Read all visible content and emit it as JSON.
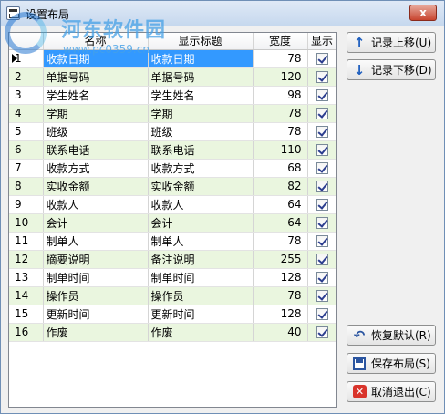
{
  "window": {
    "title": "设置布局",
    "close_label": "x"
  },
  "watermark": {
    "site": "河东软件园",
    "url": "www.pc0359.cn"
  },
  "grid": {
    "columns": [
      "",
      "名称",
      "显示标题",
      "宽度",
      "显示"
    ],
    "rows": [
      {
        "num": "1",
        "name": "收款日期",
        "display": "收款日期",
        "width": "78",
        "shown": true
      },
      {
        "num": "2",
        "name": "单据号码",
        "display": "单据号码",
        "width": "120",
        "shown": true
      },
      {
        "num": "3",
        "name": "学生姓名",
        "display": "学生姓名",
        "width": "98",
        "shown": true
      },
      {
        "num": "4",
        "name": "学期",
        "display": "学期",
        "width": "78",
        "shown": true
      },
      {
        "num": "5",
        "name": "班级",
        "display": "班级",
        "width": "78",
        "shown": true
      },
      {
        "num": "6",
        "name": "联系电话",
        "display": "联系电话",
        "width": "110",
        "shown": true
      },
      {
        "num": "7",
        "name": "收款方式",
        "display": "收款方式",
        "width": "68",
        "shown": true
      },
      {
        "num": "8",
        "name": "实收金额",
        "display": "实收金额",
        "width": "82",
        "shown": true
      },
      {
        "num": "9",
        "name": "收款人",
        "display": "收款人",
        "width": "64",
        "shown": true
      },
      {
        "num": "10",
        "name": "会计",
        "display": "会计",
        "width": "64",
        "shown": true
      },
      {
        "num": "11",
        "name": "制单人",
        "display": "制单人",
        "width": "78",
        "shown": true
      },
      {
        "num": "12",
        "name": "摘要说明",
        "display": "备注说明",
        "width": "255",
        "shown": true
      },
      {
        "num": "13",
        "name": "制单时间",
        "display": "制单时间",
        "width": "128",
        "shown": true
      },
      {
        "num": "14",
        "name": "操作员",
        "display": "操作员",
        "width": "78",
        "shown": true
      },
      {
        "num": "15",
        "name": "更新时间",
        "display": "更新时间",
        "width": "128",
        "shown": true
      },
      {
        "num": "16",
        "name": "作废",
        "display": "作废",
        "width": "40",
        "shown": true
      }
    ]
  },
  "buttons": {
    "move_up": "记录上移(U)",
    "move_down": "记录下移(D)",
    "restore": "恢复默认(R)",
    "save": "保存布局(S)",
    "cancel": "取消退出(C)"
  },
  "icons": {
    "move_up": "arrow-up-icon",
    "move_down": "arrow-down-icon",
    "restore": "undo-icon",
    "save": "save-icon",
    "cancel": "cancel-icon"
  },
  "colors": {
    "selection": "#3399ff",
    "alt_row": "#eaf6df",
    "titlebar": "#c6d8ee",
    "close": "#c8452f"
  }
}
